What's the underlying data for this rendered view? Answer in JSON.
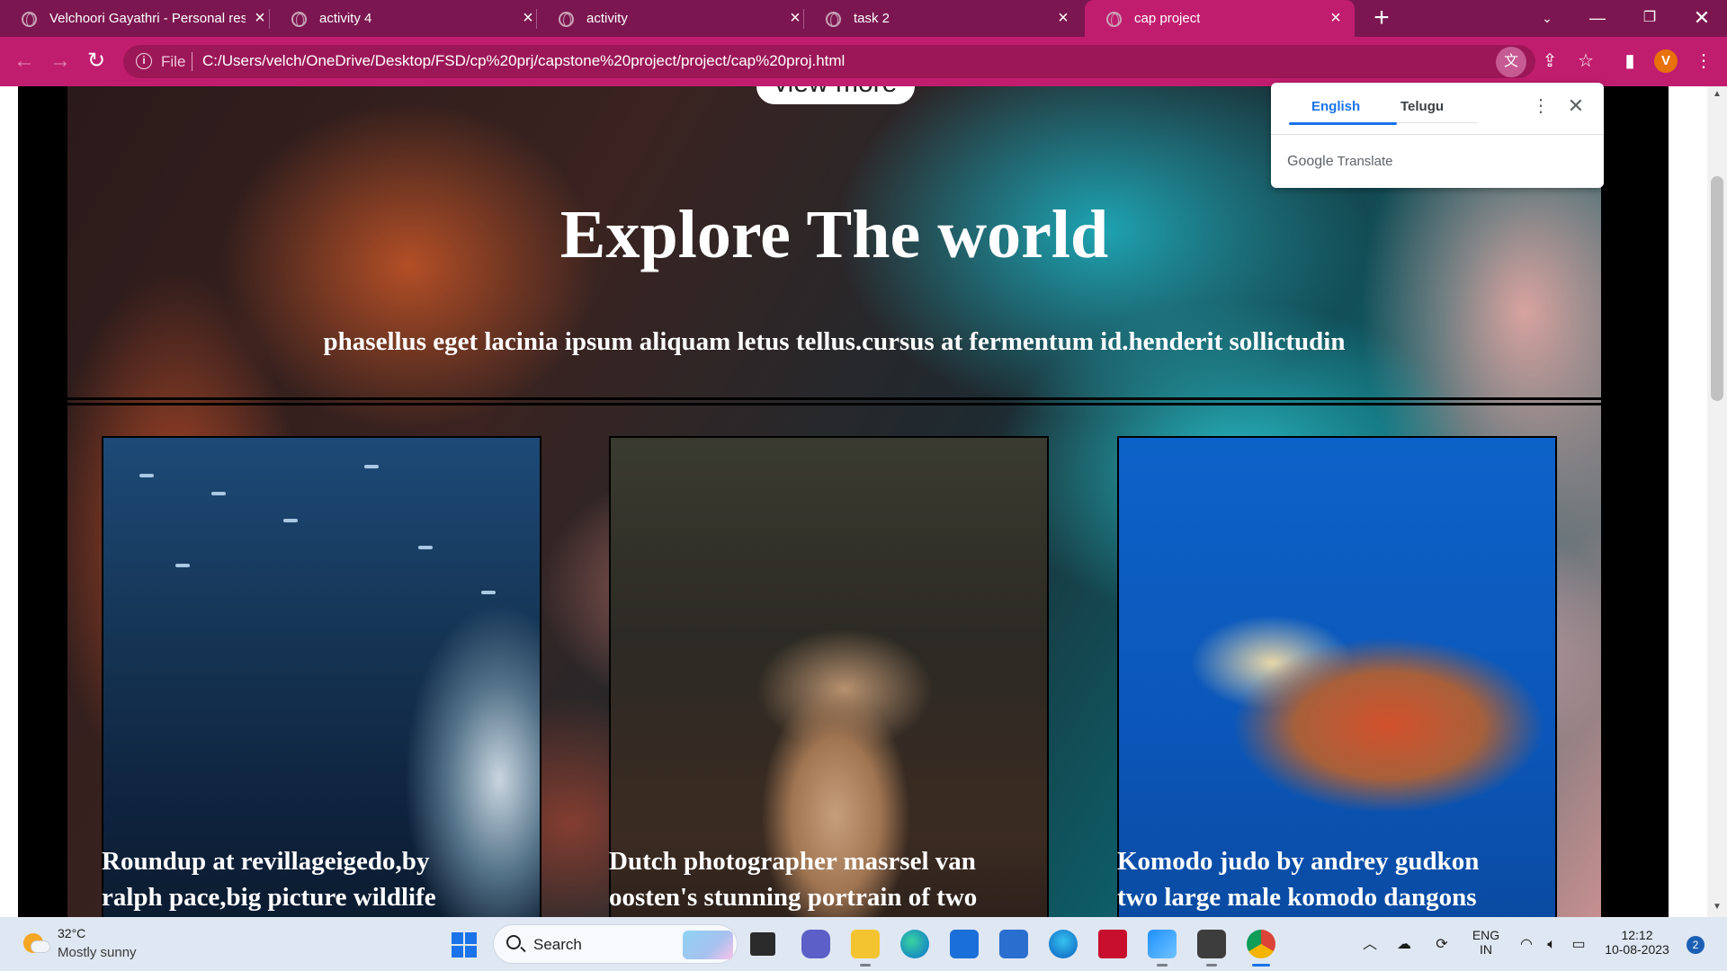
{
  "browser": {
    "tabs": [
      {
        "label": "Velchoori Gayathri - Personal resume",
        "active": false
      },
      {
        "label": "activity 4",
        "active": false
      },
      {
        "label": "activity",
        "active": false
      },
      {
        "label": "task 2",
        "active": false
      },
      {
        "label": "cap project",
        "active": true
      }
    ],
    "new_tab_label": "+",
    "address": {
      "scheme_label": "File",
      "url": "C:/Users/velch/OneDrive/Desktop/FSD/cp%20prj/capstone%20project/project/cap%20proj.html"
    },
    "profile_initial": "V",
    "accent_color": "#c11d6e",
    "tabstrip_color": "#7b1650"
  },
  "translate_popup": {
    "languages": [
      "English",
      "Telugu"
    ],
    "selected": "English",
    "brand": "Google",
    "brand_suffix": "Translate"
  },
  "page": {
    "view_more_label": "view more",
    "hero_title": "Explore The world",
    "hero_subtitle": "phasellus eget lacinia ipsum aliquam letus tellus.cursus at fermentum id.henderit sollictudin",
    "cards": [
      {
        "image": "whale-shark-photo",
        "caption_line1": "Roundup at revillageigedo,by",
        "caption_line2": "ralph pace,big picture wildlife"
      },
      {
        "image": "monkey-photo",
        "caption_line1": "Dutch photographer masrsel van",
        "caption_line2": "oosten's stunning portrain of two"
      },
      {
        "image": "sea-turtle-photo",
        "caption_line1": "Komodo judo by andrey gudkon",
        "caption_line2": "two large male komodo dangons"
      }
    ]
  },
  "taskbar": {
    "weather": {
      "temp": "32°C",
      "desc": "Mostly sunny"
    },
    "search_label": "Search",
    "language": {
      "line1": "ENG",
      "line2": "IN"
    },
    "clock": {
      "time": "12:12",
      "date": "10-08-2023"
    },
    "notifications": "2",
    "apps": [
      "task-view",
      "teams-chat",
      "file-explorer",
      "edge",
      "store",
      "app",
      "edge-beta",
      "mcafee",
      "photos",
      "sublime-text",
      "chrome"
    ]
  }
}
